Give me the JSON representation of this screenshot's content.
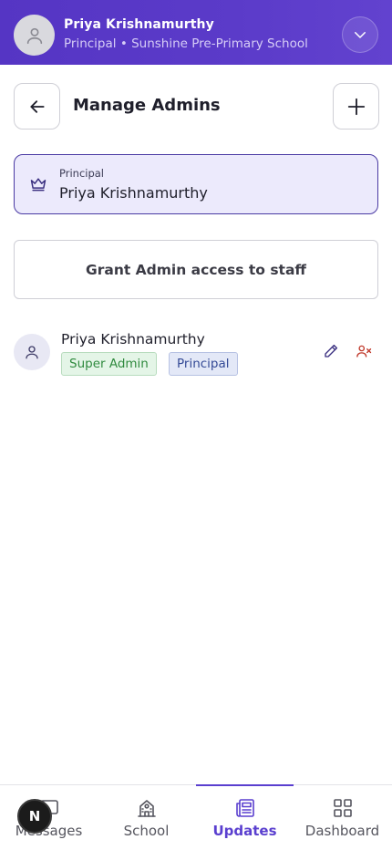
{
  "header": {
    "user_name": "Priya Krishnamurthy",
    "user_role": "Principal • Sunshine Pre-Primary School",
    "avatar_icon": "user-icon",
    "expand_icon": "chevron-down-icon"
  },
  "title_bar": {
    "title": "Manage Admins",
    "back_icon": "arrow-left-icon",
    "add_icon": "plus-icon"
  },
  "principal_card": {
    "label": "Principal",
    "name": "Priya Krishnamurthy",
    "icon": "crown-icon"
  },
  "grant_button": {
    "label": "Grant Admin access to staff"
  },
  "admins": [
    {
      "name": "Priya Krishnamurthy",
      "badges": [
        "Super Admin",
        "Principal"
      ],
      "actions": [
        "edit-icon",
        "remove-user-icon"
      ]
    }
  ],
  "bottom_nav": {
    "items": [
      {
        "label": "Messages",
        "icon": "message-icon",
        "active": false
      },
      {
        "label": "School",
        "icon": "school-icon",
        "active": false
      },
      {
        "label": "Updates",
        "icon": "newspaper-icon",
        "active": true
      },
      {
        "label": "Dashboard",
        "icon": "grid-icon",
        "active": false
      }
    ]
  },
  "floating_badge": {
    "letter": "N"
  },
  "colors": {
    "brand": "#5a3fcf",
    "super_admin_text": "#2f8a3e",
    "principal_badge_text": "#344a96",
    "remove_icon": "#c0392b"
  }
}
